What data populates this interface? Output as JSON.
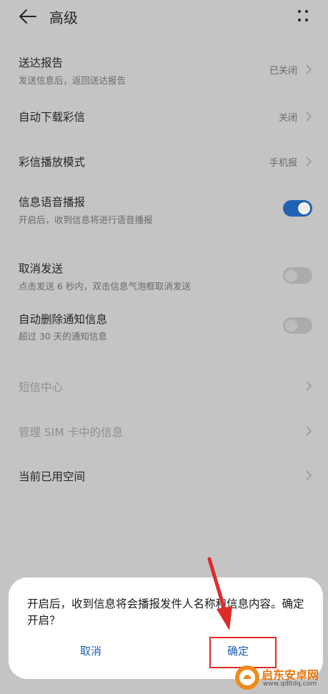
{
  "header": {
    "title": "高级",
    "back_icon": "arrow-left-icon",
    "more_icon": "more-icon"
  },
  "settings": [
    {
      "label": "送达报告",
      "sublabel": "发送信息后，返回送达报告",
      "value": "已关闭"
    },
    {
      "label": "自动下载彩信",
      "value": "关闭"
    },
    {
      "label": "彩信播放模式",
      "value": "手机报"
    },
    {
      "label": "信息语音播报",
      "sublabel": "开启后，收到信息将进行语音播报",
      "toggle": true
    },
    {
      "label": "取消发送",
      "sublabel": "点击发送 6 秒内，双击信息气泡框取消发送",
      "toggle": false
    },
    {
      "label": "自动删除通知信息",
      "sublabel": "超过 30 天的通知信息",
      "toggle": false
    },
    {
      "label": "短信中心",
      "disabled": true
    },
    {
      "label": "管理 SIM 卡中的信息",
      "disabled": true
    },
    {
      "label": "当前已用空间"
    }
  ],
  "dialog": {
    "message": "开启后，收到信息将会播报发件人名称和信息内容。确定开启？",
    "cancel_label": "取消",
    "confirm_label": "确定"
  },
  "watermark": {
    "title": "启东安卓网",
    "url": "www.qdltdq.com"
  },
  "colors": {
    "accent": "#1e63b2",
    "highlight": "#e12a2a",
    "watermark": "#e8740a"
  }
}
